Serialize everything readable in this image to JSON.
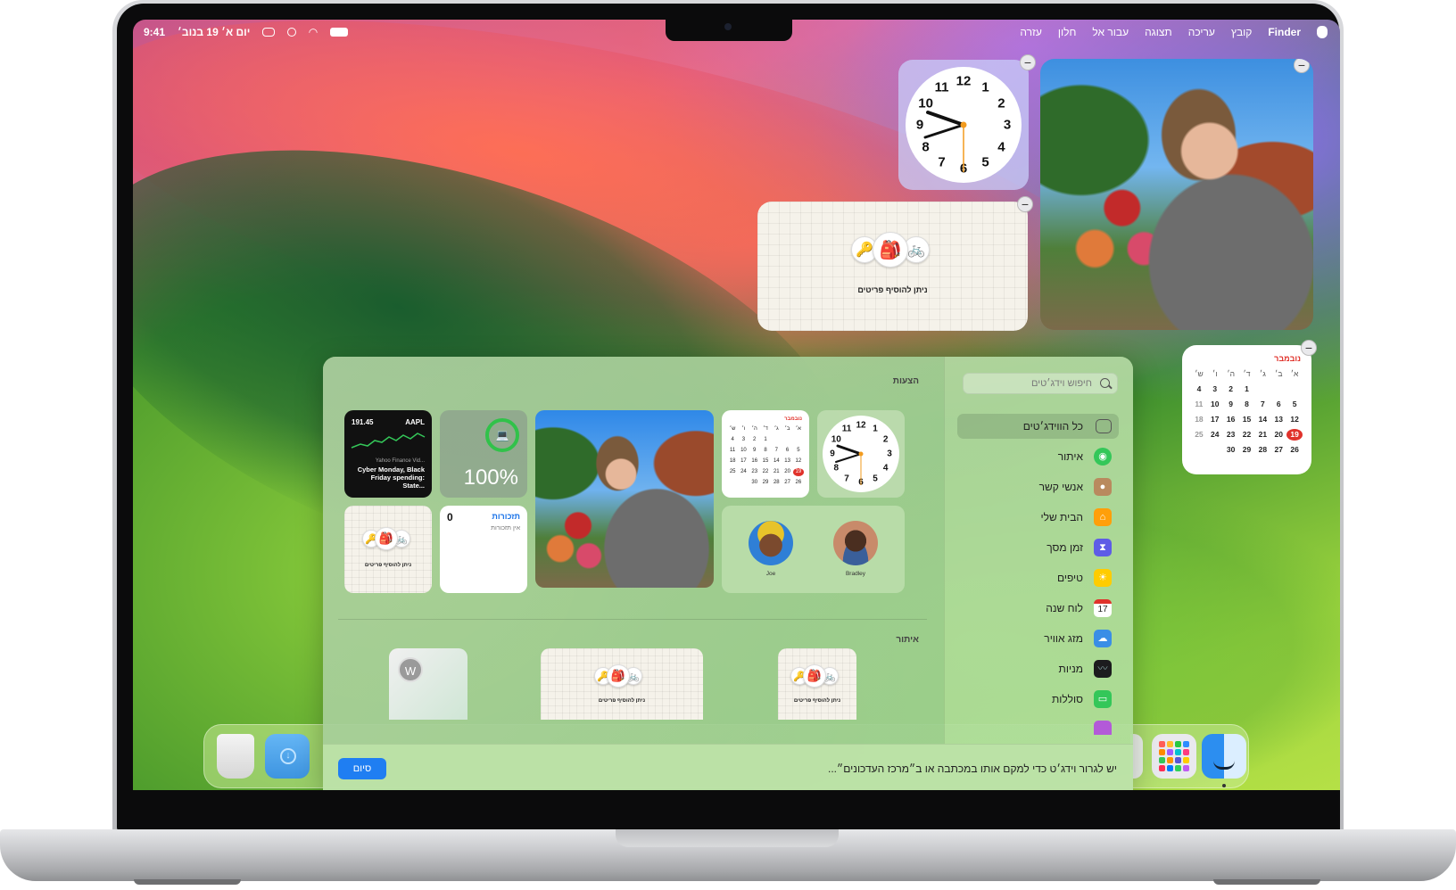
{
  "menubar": {
    "time": "9:41",
    "date": "יום א׳ 19 בנוב׳",
    "app_name": "Finder",
    "menus": [
      "קובץ",
      "עריכה",
      "תצוגה",
      "עבור אל",
      "חלון",
      "עזרה"
    ]
  },
  "desktop": {
    "clock_numbers": [
      "12",
      "1",
      "2",
      "3",
      "4",
      "5",
      "6",
      "7",
      "8",
      "9",
      "10",
      "11"
    ],
    "findmy_label": "ניתן להוסיף פריטים",
    "calendar": {
      "month": "נובמבר",
      "weekdays": [
        "א׳",
        "ב׳",
        "ג׳",
        "ד׳",
        "ה׳",
        "ו׳",
        "ש׳"
      ],
      "weeks": [
        [
          "",
          "",
          "",
          "1",
          "2",
          "3",
          "4"
        ],
        [
          "5",
          "6",
          "7",
          "8",
          "9",
          "10",
          "11"
        ],
        [
          "12",
          "13",
          "14",
          "15",
          "16",
          "17",
          "18"
        ],
        [
          "19",
          "20",
          "21",
          "22",
          "23",
          "24",
          "25"
        ],
        [
          "26",
          "27",
          "28",
          "29",
          "30",
          "",
          ""
        ]
      ],
      "today": "19"
    }
  },
  "gallery": {
    "suggestions_label": "הצעות",
    "findmy_section_label": "איתור",
    "stocks": {
      "ticker": "AAPL",
      "price": "191.45",
      "news_source": "Yahoo Finance Vid...",
      "headline": "Cyber Monday, Black Friday spending: State..."
    },
    "battery_percent": "100%",
    "reminders": {
      "title": "תזכורות",
      "count": "0",
      "empty": "אין תזכורות"
    },
    "findmy_label": "ניתן להוסיף פריטים",
    "calendar_month": "נובמבר",
    "people": [
      {
        "name": "Joe"
      },
      {
        "name": "Bradley"
      }
    ],
    "weather_letter": "W",
    "search_placeholder": "חיפוש וידג׳טים",
    "categories": [
      {
        "label": "כל הווידג׳טים",
        "icon": "widgets-icon",
        "color": "#6f7d6a"
      },
      {
        "label": "איתור",
        "icon": "findmy-icon",
        "color": "#34c759"
      },
      {
        "label": "אנשי קשר",
        "icon": "contacts-icon",
        "color": "#b98a5e"
      },
      {
        "label": "הבית שלי",
        "icon": "home-icon",
        "color": "#ff9f0a"
      },
      {
        "label": "זמן מסך",
        "icon": "hourglass-icon",
        "color": "#5e5ce6"
      },
      {
        "label": "טיפים",
        "icon": "lightbulb-icon",
        "color": "#ffcc00"
      },
      {
        "label": "לוח שנה",
        "icon": "calendar-icon",
        "color": "#ffffff"
      },
      {
        "label": "מזג אוויר",
        "icon": "weather-icon",
        "color": "#3a8ee6"
      },
      {
        "label": "מניות",
        "icon": "stocks-icon",
        "color": "#1c1c1e"
      },
      {
        "label": "סוללות",
        "icon": "battery-icon",
        "color": "#34c759"
      }
    ],
    "calendar_icon_day": "17",
    "footer_text": "יש לגרור וידג׳ט כדי למקם אותו במכתבה או ב״מרכז העדכונים״...",
    "done_label": "סיום"
  }
}
